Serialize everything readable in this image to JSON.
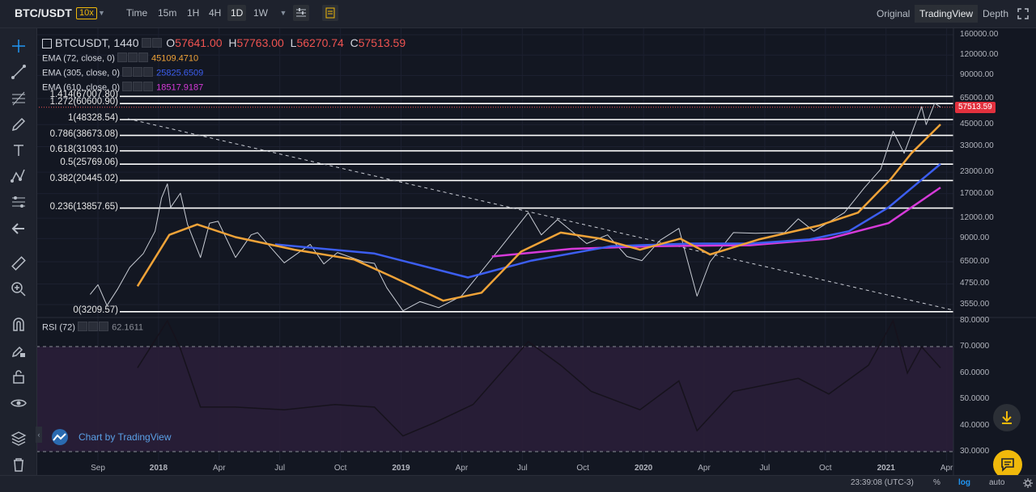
{
  "topbar": {
    "symbol": "BTC/USDT",
    "leverage": "10x",
    "timeframes": [
      {
        "label": "Time",
        "active": false
      },
      {
        "label": "15m",
        "active": false
      },
      {
        "label": "1H",
        "active": false
      },
      {
        "label": "4H",
        "active": false
      },
      {
        "label": "1D",
        "active": true
      },
      {
        "label": "1W",
        "active": false
      }
    ],
    "view_tabs": [
      {
        "label": "Original",
        "active": false
      },
      {
        "label": "TradingView",
        "active": true
      },
      {
        "label": "Depth",
        "active": false
      }
    ]
  },
  "legend": {
    "symbol": "BTCUSDT, 1440",
    "ohlc": {
      "O": "57641.00",
      "H": "57763.00",
      "L": "56270.74",
      "C": "57513.59"
    },
    "ema": [
      {
        "label": "EMA (72, close, 0)",
        "value": "45109.4710",
        "color": "#f0a338"
      },
      {
        "label": "EMA (305, close, 0)",
        "value": "25825.6509",
        "color": "#3c5ef0"
      },
      {
        "label": "EMA (610, close, 0)",
        "value": "18517.9187",
        "color": "#d63ad9"
      }
    ],
    "rsi": {
      "label": "RSI (72)",
      "value": "62.1611"
    }
  },
  "chart_data": {
    "type": "line",
    "scale": "log",
    "title": "BTCUSDT, 1440",
    "last_price": "57513.59",
    "price_axis": [
      "160000.00",
      "120000.00",
      "90000.00",
      "65000.00",
      "45000.00",
      "33000.00",
      "23000.00",
      "17000.00",
      "12000.00",
      "9000.00",
      "6500.00",
      "4750.00",
      "3550.00"
    ],
    "time_axis": [
      "Sep",
      "2018",
      "Apr",
      "Jul",
      "Oct",
      "2019",
      "Apr",
      "Jul",
      "Oct",
      "2020",
      "Apr",
      "Jul",
      "Oct",
      "2021",
      "Apr"
    ],
    "fib_levels": [
      {
        "label": "1.414(67007.80)",
        "price": 67007.8
      },
      {
        "label": "1.272(60600.90)",
        "price": 60600.9
      },
      {
        "label": "1(48328.54)",
        "price": 48328.54
      },
      {
        "label": "0.786(38673.08)",
        "price": 38673.08
      },
      {
        "label": "0.618(31093.10)",
        "price": 31093.1
      },
      {
        "label": "0.5(25769.06)",
        "price": 25769.06
      },
      {
        "label": "0.382(20445.02)",
        "price": 20445.02
      },
      {
        "label": "0.236(13857.65)",
        "price": 13857.65
      },
      {
        "label": "0(3209.57)",
        "price": 3209.57
      }
    ],
    "price_series": [
      [
        "2017-08-20",
        4100
      ],
      [
        "2017-09-01",
        4700
      ],
      [
        "2017-09-15",
        3500
      ],
      [
        "2017-10-01",
        4400
      ],
      [
        "2017-10-20",
        6000
      ],
      [
        "2017-11-10",
        7300
      ],
      [
        "2017-11-28",
        10000
      ],
      [
        "2017-12-08",
        16000
      ],
      [
        "2017-12-17",
        19500
      ],
      [
        "2017-12-22",
        14000
      ],
      [
        "2018-01-06",
        17100
      ],
      [
        "2018-01-17",
        11000
      ],
      [
        "2018-02-06",
        6900
      ],
      [
        "2018-02-20",
        11200
      ],
      [
        "2018-03-05",
        11500
      ],
      [
        "2018-04-01",
        6900
      ],
      [
        "2018-04-25",
        9500
      ],
      [
        "2018-05-05",
        9800
      ],
      [
        "2018-06-15",
        6400
      ],
      [
        "2018-07-25",
        8300
      ],
      [
        "2018-08-15",
        6300
      ],
      [
        "2018-09-05",
        7400
      ],
      [
        "2018-10-15",
        6500
      ],
      [
        "2018-11-01",
        6350
      ],
      [
        "2018-11-20",
        4500
      ],
      [
        "2018-12-15",
        3250
      ],
      [
        "2019-01-10",
        3700
      ],
      [
        "2019-02-08",
        3400
      ],
      [
        "2019-03-15",
        4000
      ],
      [
        "2019-04-02",
        4900
      ],
      [
        "2019-05-14",
        7900
      ],
      [
        "2019-06-26",
        13000
      ],
      [
        "2019-07-16",
        9500
      ],
      [
        "2019-08-10",
        11800
      ],
      [
        "2019-09-24",
        8400
      ],
      [
        "2019-10-26",
        9500
      ],
      [
        "2019-11-25",
        7000
      ],
      [
        "2019-12-18",
        6600
      ],
      [
        "2020-01-15",
        8800
      ],
      [
        "2020-02-13",
        10400
      ],
      [
        "2020-03-12",
        4000
      ],
      [
        "2020-04-01",
        6500
      ],
      [
        "2020-05-07",
        9800
      ],
      [
        "2020-06-10",
        9700
      ],
      [
        "2020-07-25",
        9800
      ],
      [
        "2020-08-15",
        11900
      ],
      [
        "2020-09-08",
        10000
      ],
      [
        "2020-10-25",
        13000
      ],
      [
        "2020-11-25",
        18500
      ],
      [
        "2020-12-20",
        24000
      ],
      [
        "2021-01-08",
        41000
      ],
      [
        "2021-01-25",
        30000
      ],
      [
        "2021-02-21",
        58000
      ],
      [
        "2021-02-28",
        45000
      ],
      [
        "2021-03-13",
        61000
      ],
      [
        "2021-03-22",
        57513
      ]
    ],
    "ema_72": [
      [
        "2017-11-01",
        4600
      ],
      [
        "2017-12-20",
        9500
      ],
      [
        "2018-02-01",
        11000
      ],
      [
        "2018-04-01",
        9200
      ],
      [
        "2018-07-01",
        7700
      ],
      [
        "2018-10-01",
        6700
      ],
      [
        "2018-12-01",
        5200
      ],
      [
        "2019-02-15",
        3750
      ],
      [
        "2019-04-15",
        4200
      ],
      [
        "2019-06-15",
        7500
      ],
      [
        "2019-08-15",
        9800
      ],
      [
        "2019-10-15",
        9000
      ],
      [
        "2019-12-15",
        7700
      ],
      [
        "2020-02-15",
        9000
      ],
      [
        "2020-04-01",
        7200
      ],
      [
        "2020-06-15",
        8900
      ],
      [
        "2020-09-15",
        10800
      ],
      [
        "2020-11-15",
        13000
      ],
      [
        "2021-01-05",
        21000
      ],
      [
        "2021-02-05",
        30000
      ],
      [
        "2021-03-22",
        45109
      ]
    ],
    "ema_305": [
      [
        "2018-06-01",
        8300
      ],
      [
        "2018-11-01",
        7300
      ],
      [
        "2019-03-25",
        5200
      ],
      [
        "2019-07-01",
        6600
      ],
      [
        "2019-11-01",
        8100
      ],
      [
        "2020-03-01",
        8400
      ],
      [
        "2020-06-01",
        8400
      ],
      [
        "2020-09-01",
        8900
      ],
      [
        "2020-11-01",
        10000
      ],
      [
        "2021-01-01",
        14000
      ],
      [
        "2021-03-22",
        25825
      ]
    ],
    "ema_610": [
      [
        "2019-05-01",
        7000
      ],
      [
        "2019-09-01",
        7800
      ],
      [
        "2020-01-01",
        8100
      ],
      [
        "2020-06-01",
        8200
      ],
      [
        "2020-10-01",
        9000
      ],
      [
        "2021-01-01",
        11200
      ],
      [
        "2021-03-22",
        18517
      ]
    ],
    "rsi_axis": [
      "80.0000",
      "70.0000",
      "60.0000",
      "50.0000",
      "40.0000",
      "30.0000"
    ],
    "rsi_bands": [
      70,
      30
    ],
    "rsi_series": [
      [
        "2017-11-01",
        62
      ],
      [
        "2017-12-17",
        80
      ],
      [
        "2018-01-05",
        70
      ],
      [
        "2018-02-06",
        47
      ],
      [
        "2018-04-01",
        47
      ],
      [
        "2018-06-15",
        46
      ],
      [
        "2018-09-01",
        48
      ],
      [
        "2018-11-01",
        47
      ],
      [
        "2018-12-15",
        36
      ],
      [
        "2019-02-01",
        41
      ],
      [
        "2019-04-02",
        48
      ],
      [
        "2019-06-26",
        72
      ],
      [
        "2019-08-15",
        63
      ],
      [
        "2019-10-01",
        53
      ],
      [
        "2019-12-15",
        46
      ],
      [
        "2020-02-13",
        57
      ],
      [
        "2020-03-12",
        38
      ],
      [
        "2020-05-07",
        53
      ],
      [
        "2020-08-15",
        58
      ],
      [
        "2020-10-01",
        52
      ],
      [
        "2020-12-01",
        63
      ],
      [
        "2021-01-08",
        80
      ],
      [
        "2021-01-30",
        60
      ],
      [
        "2021-02-21",
        70
      ],
      [
        "2021-03-22",
        62
      ]
    ]
  },
  "watermark": "Chart by TradingView",
  "bottombar": {
    "clock": "23:39:08 (UTC-3)",
    "percent": "%",
    "log": "log",
    "auto": "auto"
  },
  "icons": {
    "topbar": [
      "caret-down-icon",
      "indicators-icon",
      "templates-icon"
    ],
    "left_toolbar": [
      "crosshair-icon",
      "trend-line-icon",
      "fib-tool-icon",
      "brush-icon",
      "text-icon",
      "pattern-icon",
      "prediction-icon",
      "back-arrow-icon",
      "ruler-icon",
      "zoom-in-icon",
      "magnet-icon",
      "lock-drawing-icon",
      "lock-icon",
      "eye-icon",
      "layers-icon",
      "trash-icon"
    ]
  }
}
